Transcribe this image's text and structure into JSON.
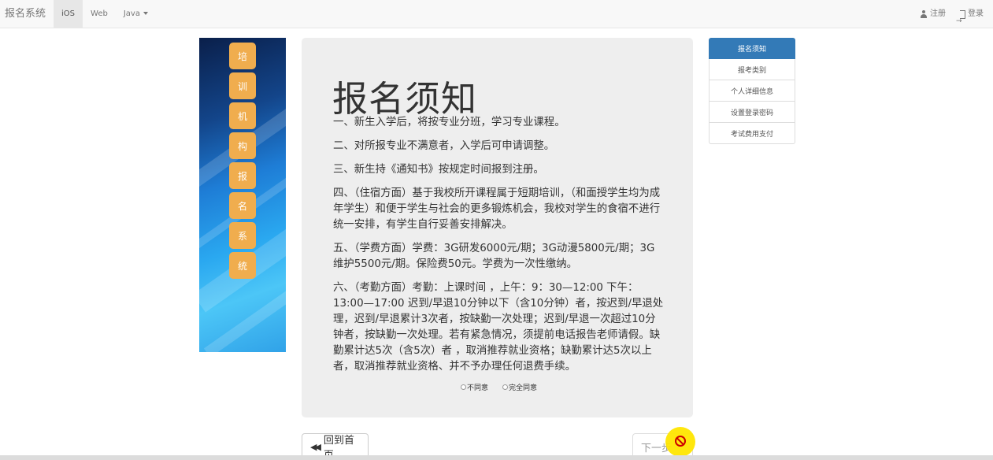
{
  "navbar": {
    "brand": "报名系统",
    "links": [
      "iOS",
      "Web",
      "Java"
    ],
    "register": "注册",
    "login": "登录"
  },
  "banner": {
    "chars": [
      "培",
      "训",
      "机",
      "构",
      "报",
      "名",
      "系",
      "统"
    ]
  },
  "main": {
    "title": "报名须知",
    "paragraphs": [
      "一、新生入学后，将按专业分班，学习专业课程。",
      "二、对所报专业不满意者，入学后可申请调整。",
      "三、新生持《通知书》按规定时间报到注册。",
      "四、（住宿方面）基于我校所开课程属于短期培训，（和面授学生均为成年学生）和便于学生与社会的更多锻炼机会，我校对学生的食宿不进行统一安排，有学生自行妥善安排解决。",
      "五、（学费方面）学费：3G研发6000元/期；3G动漫5800元/期；3G维护5500元/期。保险费50元。学费为一次性缴纳。",
      "六、（考勤方面）考勤：上课时间 ，上午：9：30—12:00 下午：13:00—17:00 迟到/早退10分钟以下（含10分钟）者，按迟到/早退处理，迟到/早退累计3次者，按缺勤一次处理；迟到/早退一次超过10分钟者，按缺勤一次处理。若有紧急情况，须提前电话报告老师请假。缺勤累计达5次（含5次）者 ，取消推荐就业资格；缺勤累计达5次以上者，取消推荐就业资格、并不予办理任何退费手续。"
    ],
    "disagree": "不同意",
    "agree": "完全同意"
  },
  "sidebar": {
    "items": [
      "报名须知",
      "报考类别",
      "个人详细信息",
      "设置登录密码",
      "考试费用支付"
    ],
    "active_index": 0
  },
  "buttons": {
    "home": "回到首页",
    "next": "下一步"
  },
  "colors": {
    "active": "#337ab7",
    "banner_char_bg": "#f0ad4e"
  }
}
